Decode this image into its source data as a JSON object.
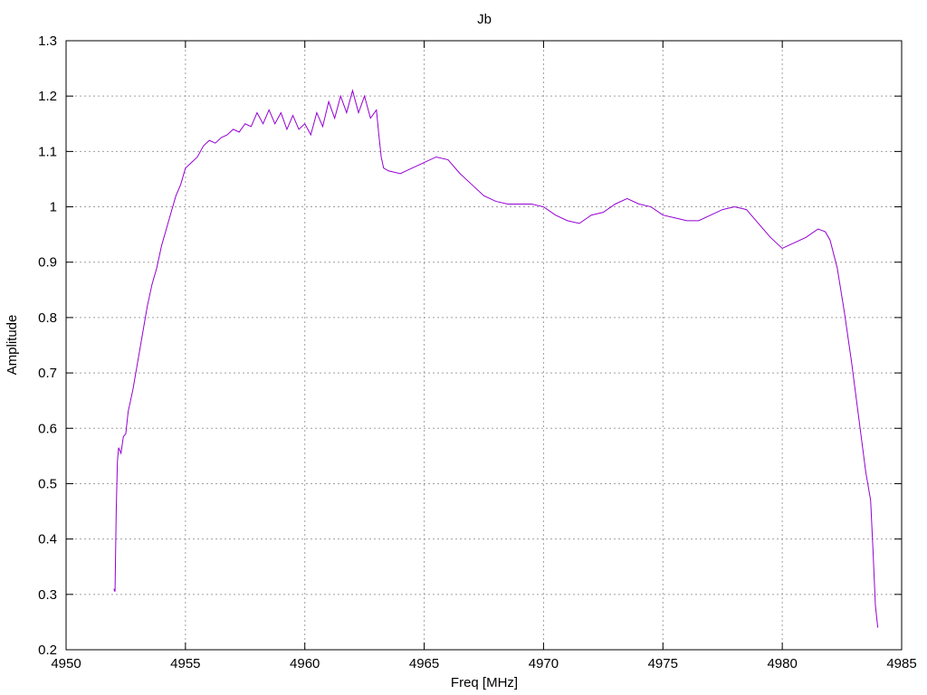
{
  "chart_data": {
    "type": "line",
    "title": "Jb",
    "xlabel": "Freq [MHz]",
    "ylabel": "Amplitude",
    "xlim": [
      4950,
      4985
    ],
    "ylim": [
      0.2,
      1.3
    ],
    "xticks": [
      4950,
      4955,
      4960,
      4965,
      4970,
      4975,
      4980,
      4985
    ],
    "xtick_labels": [
      "4950",
      "4955",
      "4960",
      "4965",
      "4970",
      "4975",
      "4980",
      "4985"
    ],
    "yticks": [
      0.2,
      0.3,
      0.4,
      0.5,
      0.6,
      0.7,
      0.8,
      0.9,
      1.0,
      1.1,
      1.2,
      1.3
    ],
    "ytick_labels": [
      "0.2",
      "0.3",
      "0.4",
      "0.5",
      "0.6",
      "0.7",
      "0.8",
      "0.9",
      "1",
      "1.1",
      "1.2",
      "1.3"
    ],
    "grid": true,
    "series": [
      {
        "color": "#9400d3",
        "x": [
          4952.0,
          4952.05,
          4952.1,
          4952.15,
          4952.2,
          4952.3,
          4952.4,
          4952.5,
          4952.6,
          4952.8,
          4953.0,
          4953.2,
          4953.4,
          4953.6,
          4953.8,
          4954.0,
          4954.2,
          4954.4,
          4954.6,
          4954.8,
          4955.0,
          4955.25,
          4955.5,
          4955.75,
          4956.0,
          4956.25,
          4956.5,
          4956.75,
          4957.0,
          4957.25,
          4957.5,
          4957.75,
          4958.0,
          4958.25,
          4958.5,
          4958.75,
          4959.0,
          4959.25,
          4959.5,
          4959.75,
          4960.0,
          4960.25,
          4960.5,
          4960.75,
          4961.0,
          4961.25,
          4961.5,
          4961.75,
          4962.0,
          4962.25,
          4962.5,
          4962.75,
          4963.0,
          4963.1,
          4963.2,
          4963.3,
          4963.5,
          4964.0,
          4964.5,
          4965.0,
          4965.5,
          4966.0,
          4966.5,
          4967.0,
          4967.5,
          4968.0,
          4968.5,
          4969.0,
          4969.5,
          4970.0,
          4970.5,
          4971.0,
          4971.5,
          4972.0,
          4972.5,
          4973.0,
          4973.5,
          4974.0,
          4974.5,
          4975.0,
          4975.5,
          4976.0,
          4976.5,
          4977.0,
          4977.5,
          4978.0,
          4978.5,
          4979.0,
          4979.5,
          4980.0,
          4980.5,
          4981.0,
          4981.5,
          4981.8,
          4982.0,
          4982.3,
          4982.6,
          4982.9,
          4983.2,
          4983.5,
          4983.7,
          4983.8,
          4983.9,
          4984.0
        ],
        "y": [
          0.31,
          0.305,
          0.45,
          0.54,
          0.565,
          0.555,
          0.585,
          0.59,
          0.63,
          0.67,
          0.72,
          0.77,
          0.82,
          0.86,
          0.89,
          0.93,
          0.96,
          0.99,
          1.02,
          1.04,
          1.07,
          1.08,
          1.09,
          1.11,
          1.12,
          1.115,
          1.125,
          1.13,
          1.14,
          1.135,
          1.15,
          1.145,
          1.17,
          1.15,
          1.175,
          1.15,
          1.17,
          1.14,
          1.165,
          1.14,
          1.15,
          1.13,
          1.17,
          1.145,
          1.19,
          1.16,
          1.2,
          1.17,
          1.21,
          1.17,
          1.2,
          1.16,
          1.175,
          1.13,
          1.09,
          1.07,
          1.065,
          1.06,
          1.07,
          1.08,
          1.09,
          1.085,
          1.06,
          1.04,
          1.02,
          1.01,
          1.005,
          1.005,
          1.005,
          1.0,
          0.985,
          0.975,
          0.97,
          0.985,
          0.99,
          1.005,
          1.015,
          1.005,
          1.0,
          0.985,
          0.98,
          0.975,
          0.975,
          0.985,
          0.995,
          1.0,
          0.995,
          0.97,
          0.945,
          0.925,
          0.935,
          0.945,
          0.96,
          0.955,
          0.94,
          0.89,
          0.81,
          0.72,
          0.62,
          0.52,
          0.47,
          0.38,
          0.28,
          0.24
        ]
      }
    ]
  }
}
